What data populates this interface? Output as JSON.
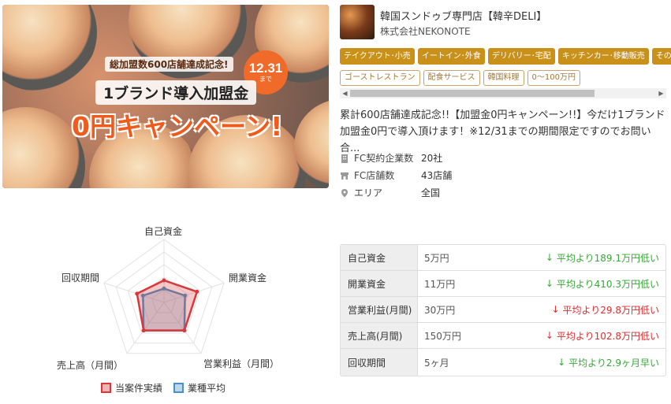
{
  "banner": {
    "subtitle": "総加盟数600店舗達成記念!",
    "title": "1ブランド導入加盟金",
    "big": "0円キャンペーン!",
    "date": "12.31",
    "date_suffix": "まで"
  },
  "header": {
    "shop_name": "韓国スンドゥブ専門店【韓辛DELI】",
    "company": "株式会社NEKONOTE"
  },
  "tags_primary": [
    "テイクアウト･小売",
    "イートイン･外食",
    "デリバリー･宅配",
    "キッチンカー･移動販売",
    "その他"
  ],
  "tags_secondary": [
    "ゴーストレストラン",
    "配食サービス",
    "韓国料理",
    "0〜100万円"
  ],
  "description": "累計600店舗達成記念!!【加盟金0円キャンペーン!!】今だけ1ブランド加盟金0円で導入頂けます！※12/31までの期間限定ですのでお問い合...",
  "info": [
    {
      "label": "FC契約企業数",
      "value": "20社",
      "icon": "building-icon"
    },
    {
      "label": "FC店舗数",
      "value": "43店舗",
      "icon": "store-icon"
    },
    {
      "label": "エリア",
      "value": "全国",
      "icon": "location-pin-icon"
    }
  ],
  "radar": {
    "axes": [
      "自己資金",
      "開業資金",
      "営業利益（月間）",
      "売上高（月間）",
      "回収期間"
    ],
    "legend": [
      "当案件実績",
      "業種平均"
    ],
    "colors": {
      "case": "#d9383a",
      "average": "#4a90c2"
    },
    "case_values": [
      0.35,
      0.55,
      0.55,
      0.55,
      0.45
    ],
    "average_values": [
      0.22,
      0.35,
      0.55,
      0.55,
      0.35
    ]
  },
  "table": [
    {
      "label": "自己資金",
      "value": "5万円",
      "compare": "平均より189.1万円低い",
      "trend": "up"
    },
    {
      "label": "開業資金",
      "value": "11万円",
      "compare": "平均より410.3万円低い",
      "trend": "up"
    },
    {
      "label": "営業利益(月間)",
      "value": "30万円",
      "compare": "平均より29.8万円低い",
      "trend": "dn"
    },
    {
      "label": "売上高(月間)",
      "value": "150万円",
      "compare": "平均より102.8万円低い",
      "trend": "dn"
    },
    {
      "label": "回収期間",
      "value": "5ヶ月",
      "compare": "平均より2.9ヶ月早い",
      "trend": "up"
    }
  ]
}
